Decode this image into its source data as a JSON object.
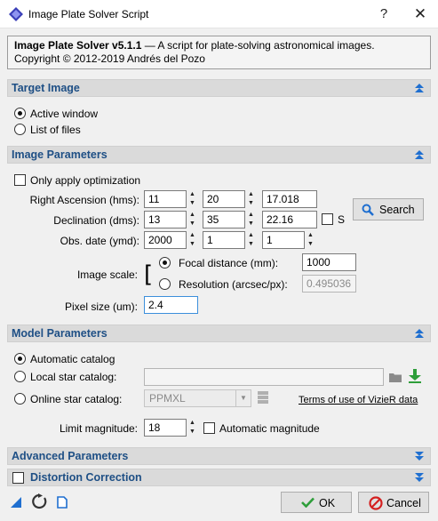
{
  "window": {
    "title": "Image Plate Solver Script",
    "help_glyph": "?",
    "close_glyph": "✕"
  },
  "info": {
    "name": "Image Plate Solver v5.1.1",
    "description": " — A script for plate-solving astronomical images.",
    "copyright": "Copyright © 2012-2019 Andrés del Pozo"
  },
  "target_image": {
    "header": "Target Image",
    "active_window": "Active window",
    "list_of_files": "List of files",
    "selected": "active_window"
  },
  "image_parameters": {
    "header": "Image Parameters",
    "only_apply_optimization": "Only apply optimization",
    "ra_label": "Right Ascension (hms):",
    "ra": [
      "11",
      "20",
      "17.018"
    ],
    "dec_label": "Declination (dms):",
    "dec": [
      "13",
      "35",
      "22.16"
    ],
    "south_label": "S",
    "obs_date_label": "Obs. date (ymd):",
    "obs_date": [
      "2000",
      "1",
      "1"
    ],
    "search_label": "Search",
    "image_scale_label": "Image scale:",
    "focal_distance_label": "Focal distance (mm):",
    "focal_distance": "1000",
    "resolution_label": "Resolution (arcsec/px):",
    "resolution": "0.495036",
    "pixel_size_label": "Pixel size (um):",
    "pixel_size": "2.4"
  },
  "model_parameters": {
    "header": "Model Parameters",
    "automatic_catalog": "Automatic catalog",
    "local_star_catalog": "Local star catalog:",
    "local_catalog_path": "",
    "online_star_catalog": "Online star catalog:",
    "online_catalog_value": "PPMXL",
    "terms_link": "Terms of use of VizieR data",
    "limit_magnitude_label": "Limit magnitude:",
    "limit_magnitude": "18",
    "automatic_magnitude": "Automatic magnitude"
  },
  "advanced_parameters": {
    "header": "Advanced Parameters"
  },
  "distortion_correction": {
    "header": "Distortion Correction"
  },
  "footer": {
    "ok_label": "OK",
    "cancel_label": "Cancel"
  },
  "colors": {
    "section_title": "#1e4f85",
    "section_header_bg": "#dadada",
    "accent_blue": "#1f6fd0",
    "ok_green": "#2e9e3a",
    "cancel_red": "#d42020",
    "download_green": "#2e9e3a"
  }
}
